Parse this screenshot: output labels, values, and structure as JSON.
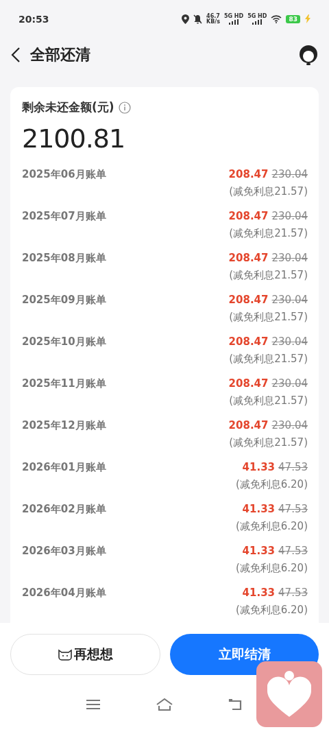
{
  "status_bar": {
    "time": "20:53",
    "speed": "46.7",
    "speed_unit": "KB/s",
    "signals": [
      "5G HD",
      "5G HD"
    ],
    "battery": "83"
  },
  "header": {
    "title": "全部还清"
  },
  "card": {
    "label": "剩余未还金额(元)",
    "amount": "2100.81",
    "bills": [
      {
        "month": "2025年06月账单",
        "amount": "208.47",
        "original": "230.04",
        "waiver": "(减免利息21.57)"
      },
      {
        "month": "2025年07月账单",
        "amount": "208.47",
        "original": "230.04",
        "waiver": "(减免利息21.57)"
      },
      {
        "month": "2025年08月账单",
        "amount": "208.47",
        "original": "230.04",
        "waiver": "(减免利息21.57)"
      },
      {
        "month": "2025年09月账单",
        "amount": "208.47",
        "original": "230.04",
        "waiver": "(减免利息21.57)"
      },
      {
        "month": "2025年10月账单",
        "amount": "208.47",
        "original": "230.04",
        "waiver": "(减免利息21.57)"
      },
      {
        "month": "2025年11月账单",
        "amount": "208.47",
        "original": "230.04",
        "waiver": "(减免利息21.57)"
      },
      {
        "month": "2025年12月账单",
        "amount": "208.47",
        "original": "230.04",
        "waiver": "(减免利息21.57)"
      },
      {
        "month": "2026年01月账单",
        "amount": "41.33",
        "original": "47.53",
        "waiver": "(减免利息6.20)"
      },
      {
        "month": "2026年02月账单",
        "amount": "41.33",
        "original": "47.53",
        "waiver": "(减免利息6.20)"
      },
      {
        "month": "2026年03月账单",
        "amount": "41.33",
        "original": "47.53",
        "waiver": "(减免利息6.20)"
      },
      {
        "month": "2026年04月账单",
        "amount": "41.33",
        "original": "47.53",
        "waiver": "(减免利息6.20)"
      }
    ]
  },
  "buttons": {
    "secondary": "再想想",
    "primary": "立即结清"
  }
}
